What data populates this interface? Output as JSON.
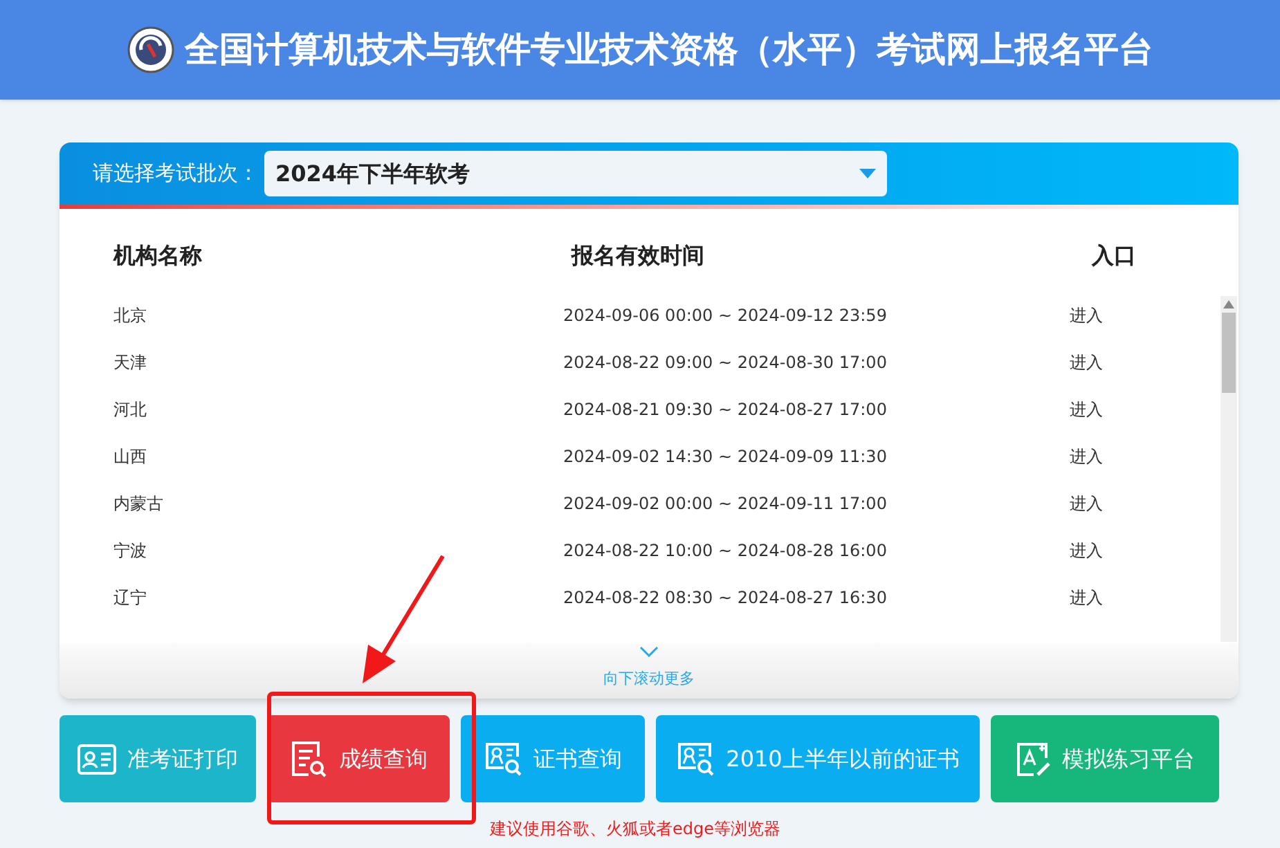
{
  "header": {
    "title": "全国计算机技术与软件专业技术资格（水平）考试网上报名平台"
  },
  "exam_batch": {
    "label": "请选择考试批次：",
    "value": "2024年下半年软考"
  },
  "table": {
    "columns": [
      "机构名称",
      "报名有效时间",
      "入口"
    ],
    "rows": [
      {
        "name": "北京",
        "period": "2024-09-06 00:00 ~ 2024-09-12 23:59",
        "entry": "进入"
      },
      {
        "name": "天津",
        "period": "2024-08-22 09:00 ~ 2024-08-30 17:00",
        "entry": "进入"
      },
      {
        "name": "河北",
        "period": "2024-08-21 09:30 ~ 2024-08-27 17:00",
        "entry": "进入"
      },
      {
        "name": "山西",
        "period": "2024-09-02 14:30 ~ 2024-09-09 11:30",
        "entry": "进入"
      },
      {
        "name": "内蒙古",
        "period": "2024-09-02 00:00 ~ 2024-09-11 17:00",
        "entry": "进入"
      },
      {
        "name": "宁波",
        "period": "2024-08-22 10:00 ~ 2024-08-28 16:00",
        "entry": "进入"
      },
      {
        "name": "辽宁",
        "period": "2024-08-22 08:30 ~ 2024-08-27 16:30",
        "entry": "进入"
      }
    ],
    "scroll_hint": "向下滚动更多"
  },
  "buttons": [
    {
      "kind": "admit",
      "label": "准考证打印",
      "color": "#1cb5c9"
    },
    {
      "kind": "score",
      "label": "成绩查询",
      "color": "#e8373f"
    },
    {
      "kind": "cert",
      "label": "证书查询",
      "color": "#0aaef0"
    },
    {
      "kind": "cert",
      "label": "2010上半年以前的证书",
      "color": "#0aaef0"
    },
    {
      "kind": "practice",
      "label": "模拟练习平台",
      "color": "#17b67a"
    }
  ],
  "browser_note": "建议使用谷歌、火狐或者edge等浏览器"
}
